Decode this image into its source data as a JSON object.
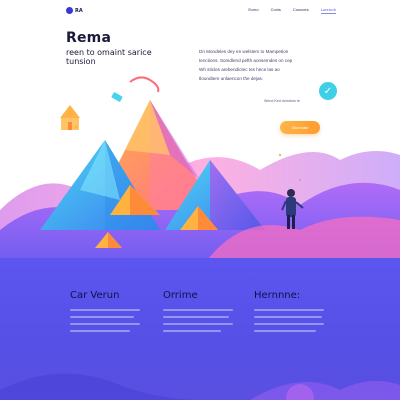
{
  "nav": {
    "logo_text": "RA",
    "links": [
      "Ecmo",
      "Conis",
      "Conoces",
      "Lonncoh"
    ]
  },
  "hero": {
    "title": "Rema",
    "subtitle_line1": "reen to omaint sarice",
    "subtitle_line2": "tunsion",
    "description": [
      "Dn Mondeles dey en welstem to Mampetion",
      "tenctions. Somdlend pefth aonsemdes on cep",
      "Wh sticles arebendictec tes hece las ao",
      "tloundtere unlaencon the dejas."
    ],
    "caption": "Wend Ked dorrsfors te",
    "cta_label": "Glkcrnoise",
    "badge_icon": "check-icon"
  },
  "features": [
    {
      "title": "Car Verun"
    },
    {
      "title": "Orrime"
    },
    {
      "title": "Hernnne:"
    }
  ],
  "colors": {
    "accent": "#5c56f0",
    "cta": "#ffa63d",
    "badge": "#3fd0e6",
    "title": "#1a1a3a"
  }
}
